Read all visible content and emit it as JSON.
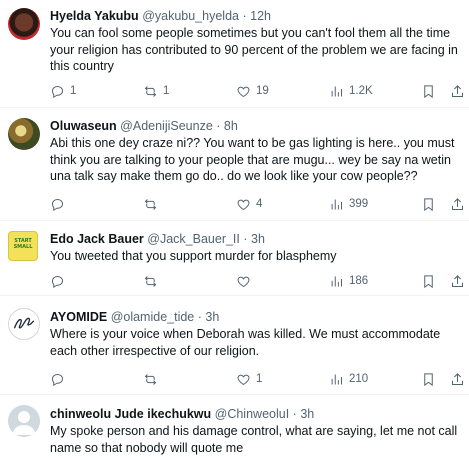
{
  "tweets": [
    {
      "name": "Hyelda Yakubu",
      "handle": "@yakubu_hyelda",
      "separator": "·",
      "time": "12h",
      "text": "You can fool some people sometimes but you can't fool them all the time your religion has contributed to 90 percent of the problem we are facing in this country",
      "replies": "1",
      "retweets": "1",
      "likes": "19",
      "views": "1.2K",
      "avatar_icon": "user-photo-avatar"
    },
    {
      "name": "Oluwaseun",
      "handle": "@AdenijiSeunze",
      "separator": "·",
      "time": "8h",
      "text": "Abi this one dey craze ni?? You want to be gas lighting is here.. you must think you are talking to your people that are mugu... wey be say na wetin una talk say make them go do.. do we look like your cow people??",
      "replies": "",
      "retweets": "",
      "likes": "4",
      "views": "399",
      "avatar_icon": "user-photo-avatar"
    },
    {
      "name": "Edo Jack Bauer",
      "handle": "@Jack_Bauer_II",
      "separator": "·",
      "time": "3h",
      "text": "You tweeted that you support murder for blasphemy",
      "replies": "",
      "retweets": "",
      "likes": "",
      "views": "186",
      "avatar_icon": "sticky-note-avatar",
      "avatar_text": "START SMALL"
    },
    {
      "name": "AYOMIDE",
      "handle": "@olamide_tide",
      "separator": "·",
      "time": "3h",
      "text": "Where is your voice when Deborah was killed. We must accommodate each other irrespective of our religion.",
      "replies": "",
      "retweets": "",
      "likes": "1",
      "views": "210",
      "avatar_icon": "signature-logo-avatar"
    },
    {
      "name": "chinweolu Jude ikechukwu",
      "handle": "@ChinweoluI",
      "separator": "·",
      "time": "3h",
      "text": "My spoke person and his damage control, what are saying, let me not call name so that nobody will quote me",
      "avatar_icon": "default-avatar"
    }
  ],
  "icons": {
    "reply": "reply-icon",
    "retweet": "retweet-icon",
    "like": "heart-icon",
    "views": "views-chart-icon",
    "bookmark": "bookmark-icon",
    "share": "share-icon"
  },
  "colors": {
    "text": "#0f1419",
    "secondary": "#536471",
    "divider": "#eff3f4"
  }
}
